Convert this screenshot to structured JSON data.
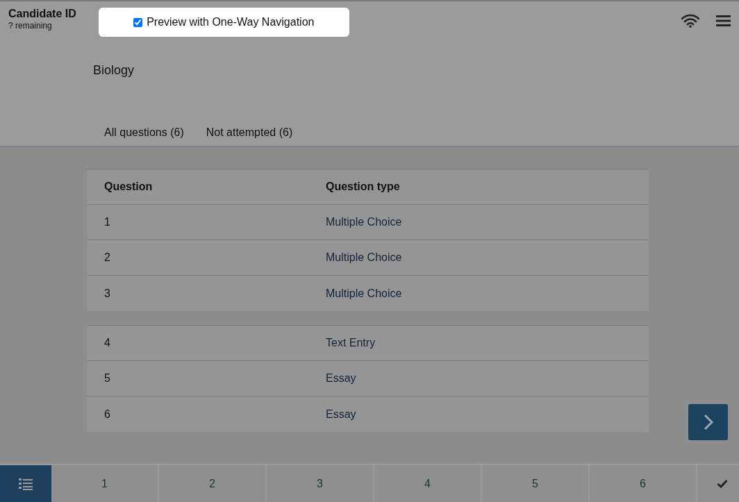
{
  "header": {
    "candidate_id": "Candidate ID",
    "remaining": "? remaining"
  },
  "preview_toggle": {
    "label": "Preview with One-Way Navigation",
    "checked": true
  },
  "section_title": "Biology",
  "tabs": [
    {
      "label": "All questions (6)"
    },
    {
      "label": "Not attempted (6)"
    }
  ],
  "table": {
    "columns": [
      "Question",
      "Question type"
    ],
    "groups": [
      [
        {
          "question": "1",
          "type": "Multiple Choice"
        },
        {
          "question": "2",
          "type": "Multiple Choice"
        },
        {
          "question": "3",
          "type": "Multiple Choice"
        }
      ],
      [
        {
          "question": "4",
          "type": "Text Entry"
        },
        {
          "question": "5",
          "type": "Essay"
        },
        {
          "question": "6",
          "type": "Essay"
        }
      ]
    ]
  },
  "question_nav": [
    "1",
    "2",
    "3",
    "4",
    "5",
    "6"
  ]
}
